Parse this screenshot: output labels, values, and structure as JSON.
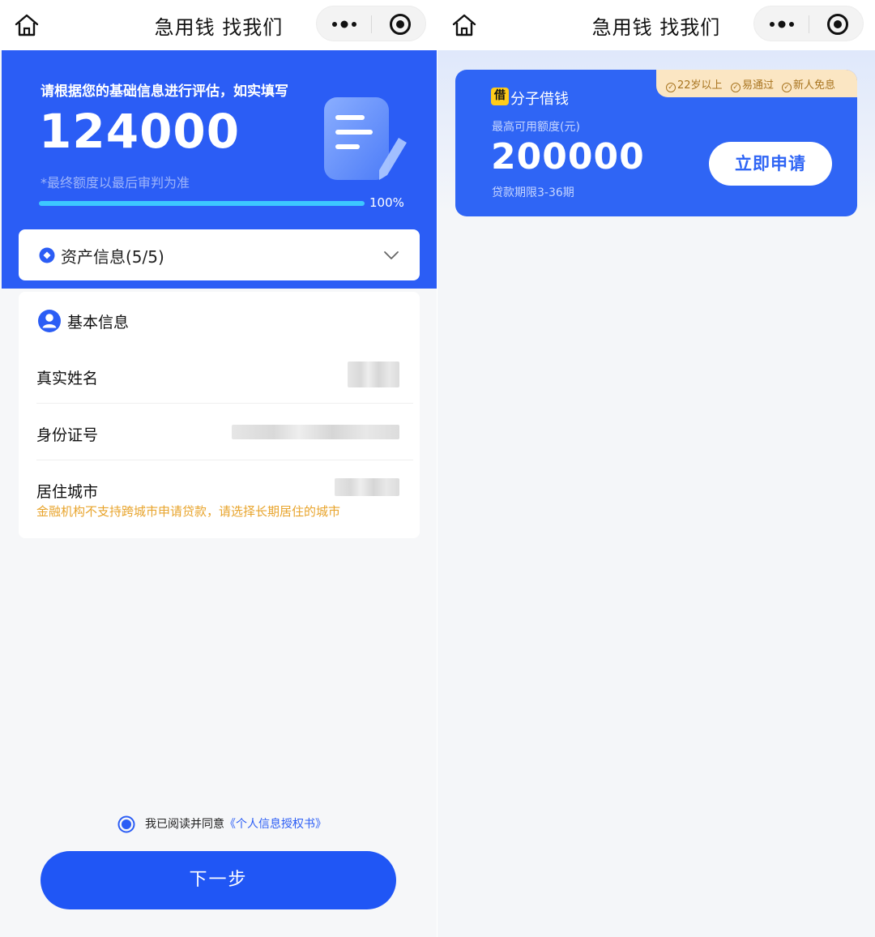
{
  "left": {
    "nav": {
      "title": "急用钱 找我们"
    },
    "hero": {
      "hint": "请根据您的基础信息进行评估，如实填写",
      "amount": "124000",
      "note": "*最终额度以最后审判为准",
      "progress": 1.0,
      "progress_label": "100%"
    },
    "asset": {
      "label": "资产信息(5/5)"
    },
    "basic_info": {
      "title": "基本信息",
      "rows": [
        {
          "label": "真实姓名"
        },
        {
          "label": "身份证号"
        },
        {
          "label": "居住城市"
        }
      ],
      "city_warning": "金融机构不支持跨城市申请贷款，请选择长期居住的城市"
    },
    "agreement": {
      "prefix": "我已阅读并同意",
      "link": "《个人信息授权书》"
    },
    "next_button": "下一步"
  },
  "right": {
    "nav": {
      "title": "急用钱 找我们"
    },
    "card": {
      "tags": [
        "22岁以上",
        "易通过",
        "新人免息"
      ],
      "logo_char": "借",
      "brand": "分子借钱",
      "limit_label": "最高可用额度(元)",
      "limit_amount": "200000",
      "term": "贷款期限3-36期",
      "apply_button": "立即申请"
    }
  },
  "colors": {
    "primary_blue": "#2b5df5",
    "button_blue": "#2056f5",
    "warning_orange": "#e8a42c",
    "tag_bg": "#fbe6c3",
    "logo_yellow": "#ffcc1a"
  }
}
